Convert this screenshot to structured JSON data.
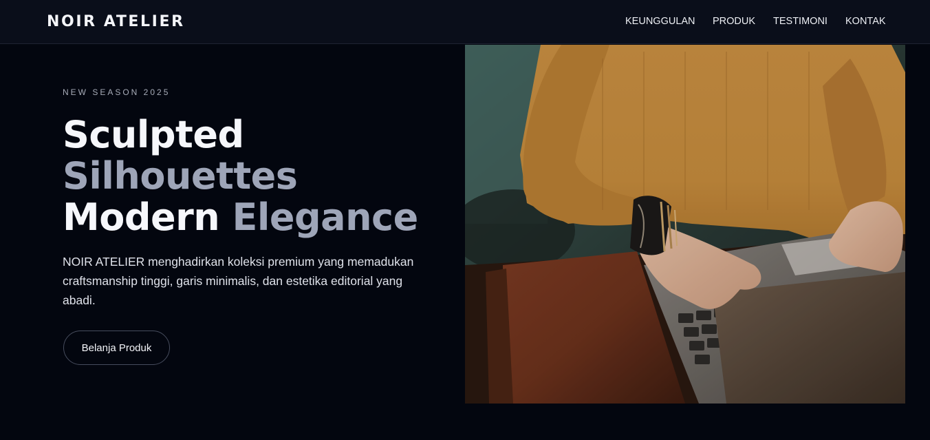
{
  "brand": {
    "name": "NOIR ATELIER"
  },
  "nav": {
    "items": [
      {
        "label": "KEUNGGULAN"
      },
      {
        "label": "PRODUK"
      },
      {
        "label": "TESTIMONI"
      },
      {
        "label": "KONTAK"
      }
    ]
  },
  "hero": {
    "eyebrow": "NEW SEASON 2025",
    "headline": {
      "word1": "Sculpted",
      "word2": "Silhouettes",
      "word3": "Modern",
      "word4": "Elegance"
    },
    "description": "NOIR ATELIER menghadirkan koleksi premium yang memadukan craftsmanship tinggi, garis minimalis, dan estetika editorial yang abadi.",
    "cta_label": "Belanja Produk",
    "image": {
      "subject": "person-in-mustard-sweater-typing-on-laptop"
    }
  },
  "colors": {
    "background": "#03060f",
    "header_bg": "#0a0e1a",
    "text_primary": "#f6f7fb",
    "text_muted": "#9ea5b8",
    "sweater": "#c48a3c"
  }
}
